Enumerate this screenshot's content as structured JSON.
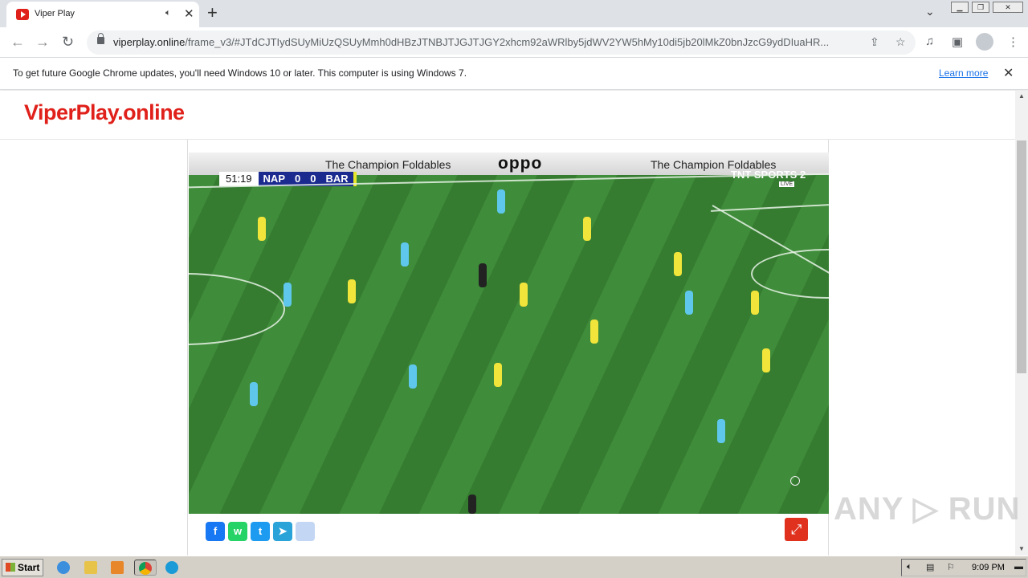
{
  "browser": {
    "tab_title": "Viper Play",
    "tab_close_glyph": "✕",
    "new_tab_glyph": "+",
    "tab_dropdown_glyph": "⌄",
    "url_host": "viperplay.online",
    "url_path": "/frame_v3/#JTdCJTIydSUyMiUzQSUyMmh0dHBzJTNBJTJGJTJGY2xhcm92aWRlby5jdWV2YW5hMy10di5jb20lMkZ0bnJzcG9ydDIuaHR...",
    "window_controls": [
      "▁",
      "❐",
      "✕"
    ],
    "info_text": "To get future Google Chrome updates, you'll need Windows 10 or later. This computer is using Windows 7.",
    "info_link": "Learn more",
    "info_close_glyph": "✕",
    "icons": [
      "back-icon",
      "forward-icon",
      "reload-icon",
      "lock-icon",
      "share-icon",
      "bookmark-star-icon",
      "media-icon",
      "sidepanel-icon",
      "profile-icon",
      "menu-icon"
    ]
  },
  "site": {
    "logo": "ViperPlay.online",
    "logo_color": "#e0201a"
  },
  "video": {
    "scorebug": {
      "clock": "51:19",
      "home": "NAP",
      "home_score": "0",
      "away_score": "0",
      "away": "BAR"
    },
    "channel": "TNT SPORTS 2",
    "channel_sub": "LIVE",
    "hoarding_1": "The Champion Foldables",
    "hoarding_oppo": "oppo",
    "hoarding_2": "The Champion Foldables"
  },
  "share": {
    "buttons": [
      "f",
      "w",
      "t",
      "➤",
      ""
    ],
    "fullscreen_glyph": "⤢"
  },
  "watermark": "ANY ▷ RUN",
  "taskbar": {
    "start": "Start",
    "clock": "9:09 PM"
  }
}
